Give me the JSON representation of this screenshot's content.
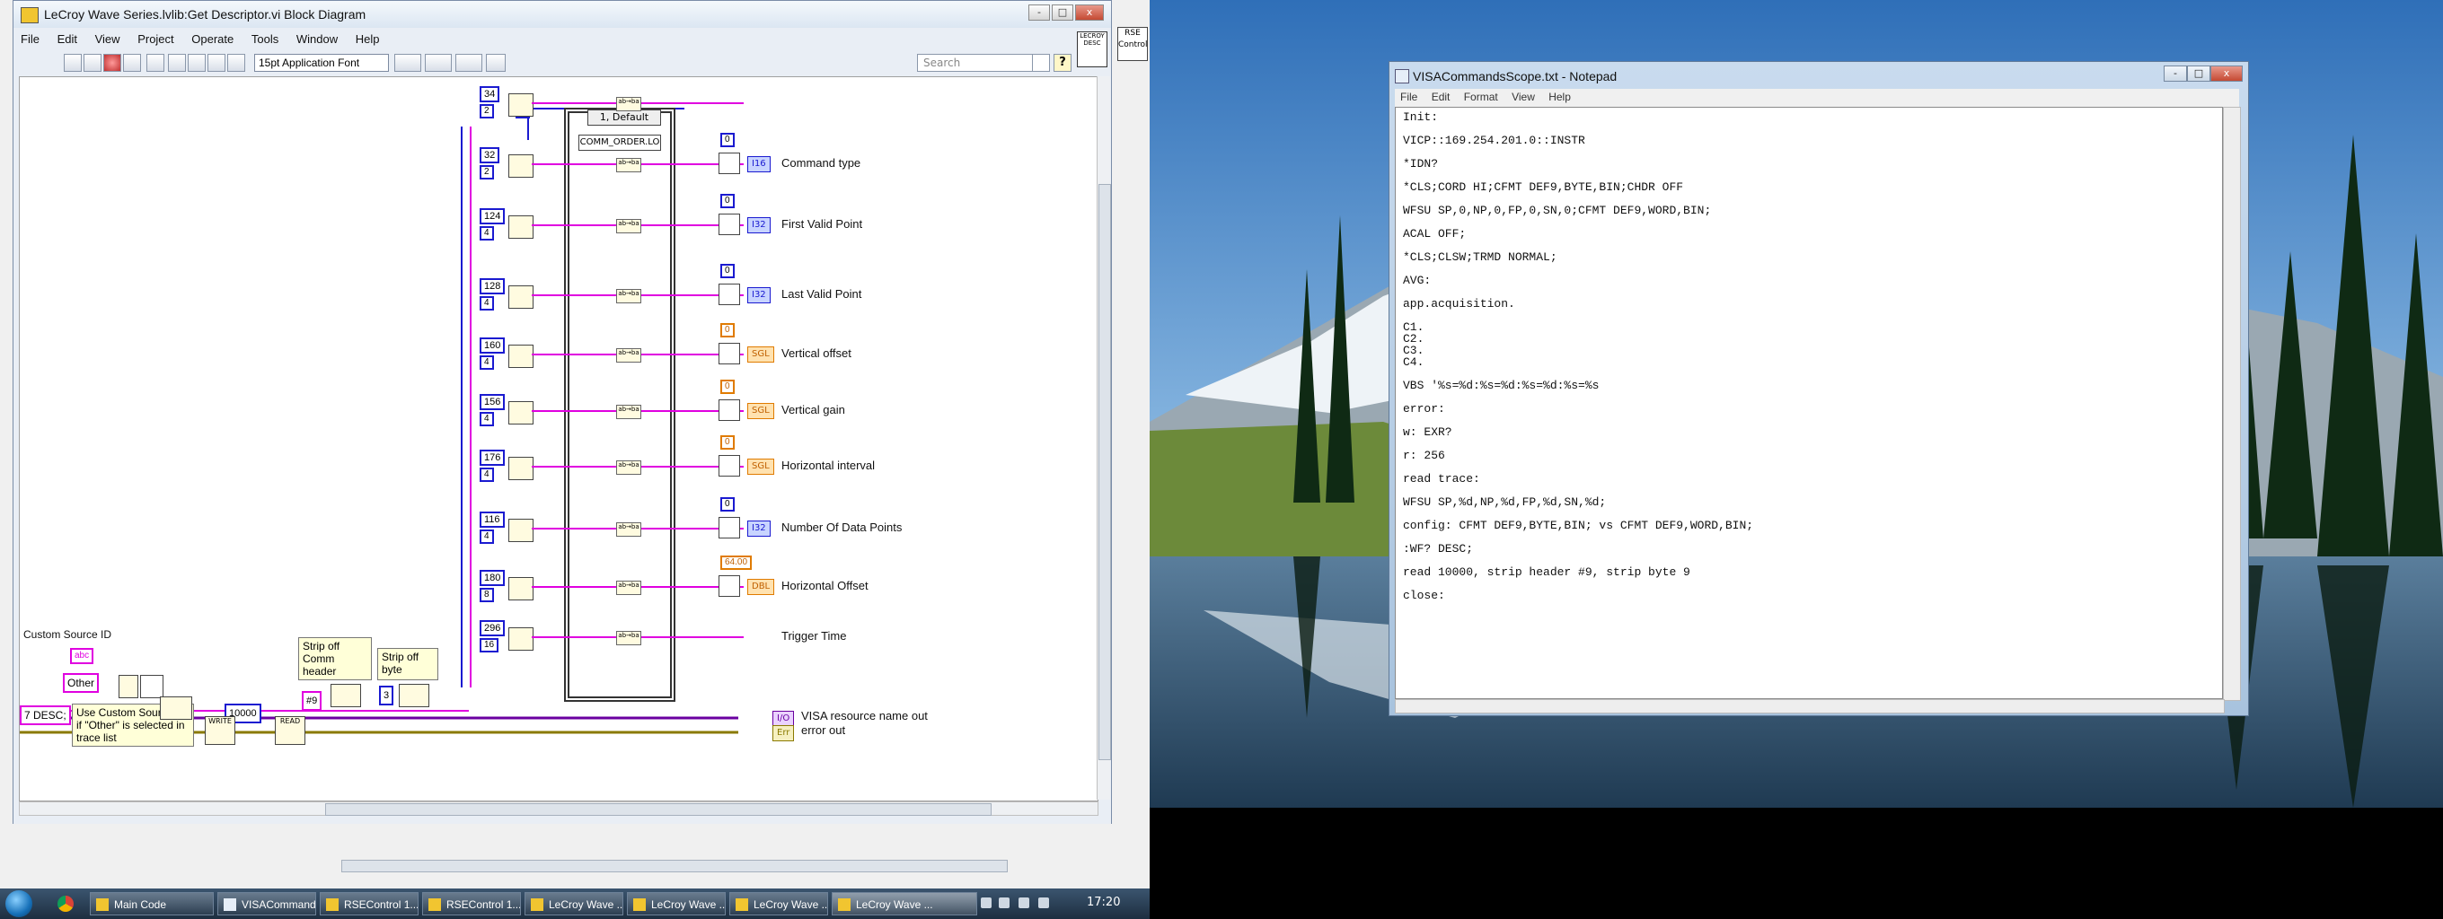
{
  "labview": {
    "title": "LeCroy Wave Series.lvlib:Get Descriptor.vi Block Diagram",
    "menu": [
      "File",
      "Edit",
      "View",
      "Project",
      "Operate",
      "Tools",
      "Window",
      "Help"
    ],
    "font_select": "15pt Application Font",
    "search_placeholder": "Search",
    "help_label": "?",
    "rse_panel": "RSE\nControl",
    "window_buttons": [
      "-",
      "□",
      "x"
    ],
    "diagram": {
      "case_selector": "1, Default",
      "case_item": "COMM_ORDER.LO",
      "case_count": "0",
      "rows": [
        {
          "offset": "34",
          "size": "2",
          "zero": "",
          "indicator_type": "",
          "indicator": ""
        },
        {
          "offset": "32",
          "size": "2",
          "zero": "0",
          "indicator_type": "I16",
          "indicator": "Command type"
        },
        {
          "offset": "124",
          "size": "4",
          "zero": "0",
          "indicator_type": "I32",
          "indicator": "First Valid Point"
        },
        {
          "offset": "128",
          "size": "4",
          "zero": "0",
          "indicator_type": "I32",
          "indicator": "Last Valid Point"
        },
        {
          "offset": "160",
          "size": "4",
          "zero": "0",
          "indicator_type": "SGL",
          "indicator": "Vertical offset"
        },
        {
          "offset": "156",
          "size": "4",
          "zero": "0",
          "indicator_type": "SGL",
          "indicator": "Vertical gain"
        },
        {
          "offset": "176",
          "size": "4",
          "zero": "0",
          "indicator_type": "SGL",
          "indicator": "Horizontal interval"
        },
        {
          "offset": "116",
          "size": "4",
          "zero": "0",
          "indicator_type": "I32",
          "indicator": "Number Of Data Points"
        },
        {
          "offset": "180",
          "size": "8",
          "zero": "64.00",
          "indicator_type": "DBL",
          "indicator": "Horizontal Offset"
        },
        {
          "offset": "296",
          "size": "16",
          "zero": "",
          "indicator_type": "",
          "indicator": "Trigger Time"
        }
      ],
      "custom_source_label": "Custom Source ID",
      "other_const": "Other",
      "desc_const": "7 DESC;",
      "note_custom": "Use Custom Source ID if \"Other\" is selected in trace list",
      "note_strip_header": "Strip off Comm header",
      "note_strip_byte": "Strip off byte",
      "const_9": "#9",
      "const_3": "3",
      "const_10000": "10000",
      "write_label": "WRITE",
      "read_label": "READ",
      "visa_out": "VISA resource name out",
      "error_out": "error out"
    }
  },
  "taskbar": {
    "items": [
      "Main Code",
      "VISACommands...",
      "RSEControl 1...",
      "RSEControl 1...",
      "LeCroy Wave ...",
      "LeCroy Wave ...",
      "LeCroy Wave ...",
      "LeCroy Wave ..."
    ],
    "clock": "17:20"
  },
  "notepad": {
    "title": "VISACommandsScope.txt - Notepad",
    "menu": [
      "File",
      "Edit",
      "Format",
      "View",
      "Help"
    ],
    "text": "Init:\n\nVICP::169.254.201.0::INSTR\n\n*IDN?\n\n*CLS;CORD HI;CFMT DEF9,BYTE,BIN;CHDR OFF\n\nWFSU SP,0,NP,0,FP,0,SN,0;CFMT DEF9,WORD,BIN;\n\nACAL OFF;\n\n*CLS;CLSW;TRMD NORMAL;\n\nAVG:\n\napp.acquisition.\n\nC1.\nC2.\nC3.\nC4.\n\nVBS '%s=%d:%s=%d:%s=%d:%s=%s\n\nerror:\n\nw: EXR?\n\nr: 256\n\nread trace:\n\nWFSU SP,%d,NP,%d,FP,%d,SN,%d;\n\nconfig: CFMT DEF9,BYTE,BIN; vs CFMT DEF9,WORD,BIN;\n\n:WF? DESC;\n\nread 10000, strip header #9, strip byte 9\n\nclose:"
  },
  "colors": {
    "wire_pink": "#e000e0",
    "wire_blue": "#1a1ad0",
    "wire_orange": "#e07b00",
    "taskbar": "#2a4057"
  }
}
